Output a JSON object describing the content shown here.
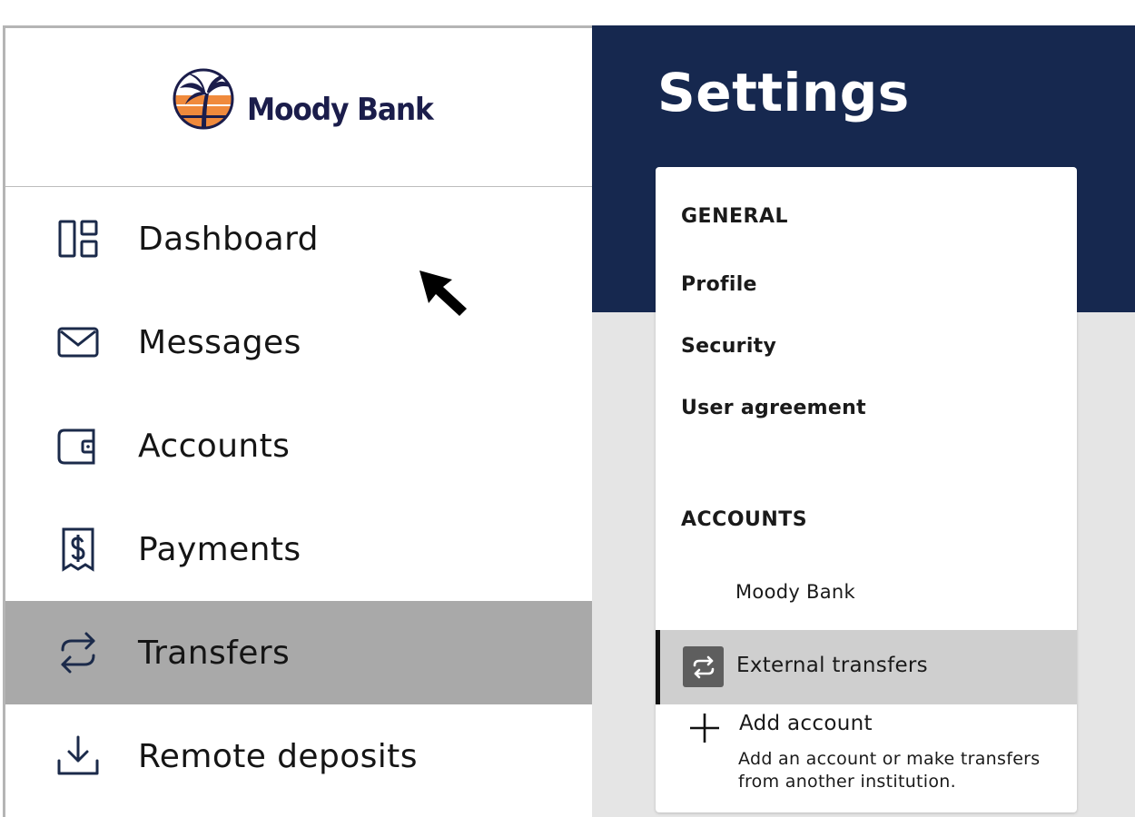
{
  "brand": {
    "name": "Moody Bank",
    "logo_icon": "palm-sunset-logo",
    "colors": {
      "navy": "#1b1d4b",
      "orange": "#f08a3c"
    }
  },
  "sidebar": {
    "items": [
      {
        "label": "Dashboard",
        "icon": "dashboard-icon",
        "active": false
      },
      {
        "label": "Messages",
        "icon": "envelope-icon",
        "active": false
      },
      {
        "label": "Accounts",
        "icon": "wallet-icon",
        "active": false
      },
      {
        "label": "Payments",
        "icon": "receipt-dollar-icon",
        "active": false
      },
      {
        "label": "Transfers",
        "icon": "transfer-arrows-icon",
        "active": true
      },
      {
        "label": "Remote deposits",
        "icon": "download-tray-icon",
        "active": false
      }
    ],
    "active_color": "#a9a9a9",
    "icon_color": "#1b2a4a"
  },
  "settings": {
    "title": "Settings",
    "header_color": "#16284f",
    "general": {
      "heading": "GENERAL",
      "links": [
        "Profile",
        "Security",
        "User agreement"
      ]
    },
    "accounts": {
      "heading": "ACCOUNTS",
      "account_name": "Moody Bank",
      "external_transfers": {
        "label": "External transfers",
        "icon": "transfer-arrows-icon"
      },
      "add_account": {
        "label": "Add account",
        "icon": "plus-icon",
        "description": "Add an account or make transfers from another institution."
      }
    }
  }
}
